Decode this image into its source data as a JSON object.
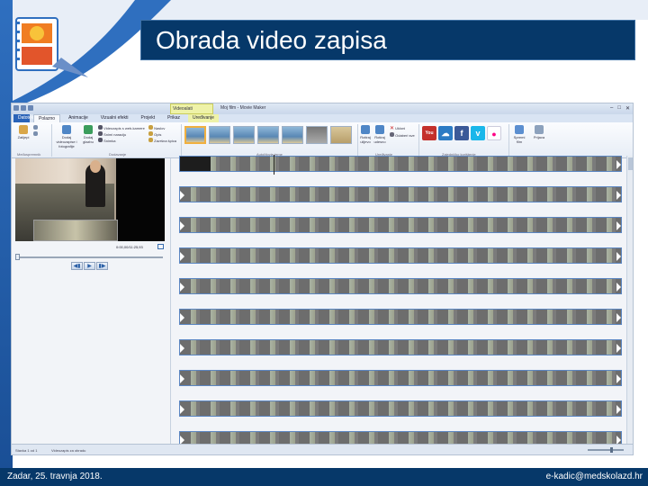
{
  "slide": {
    "title": "Obrada video zapisa",
    "footer_left": "Zadar, 25. travnja 2018.",
    "footer_right": "e-kadic@medskolazd.hr"
  },
  "colors": {
    "slide_dark_blue": "#063869",
    "accent_blue": "#2f6fbf",
    "selected_theme": "#f0b040"
  },
  "app": {
    "window_title": "Moj film - Movie Maker",
    "context_label": "Videoalati",
    "tabs": [
      "Datoteka",
      "Polazno",
      "Animacije",
      "Vizualni efekti",
      "Projekt",
      "Prikaz",
      "Uređivanje"
    ],
    "ribbon": {
      "clipboard": {
        "paste": "Zalijepi",
        "group": "Međuspremnik"
      },
      "add": {
        "add_video": "Dodaj videozapise i fotografije",
        "add_music": "Dodaj glazbu",
        "webcam": "Videozapis s web-kamere",
        "narration": "Snimi naraciju",
        "snapshot": "Snimka",
        "title": "Naslov",
        "caption": "Opis",
        "credits": "Završna špica",
        "group": "Dodavanje"
      },
      "themes_group": "AutoMovie teme",
      "editing": {
        "rotate_left": "Rotiraj ulijevo",
        "rotate_right": "Rotiraj udesno",
        "remove": "Ukloni",
        "select_all": "Odaberi sve",
        "group": "Uređivanje"
      },
      "share_group": "Zajedničko korištenje",
      "save_movie": "Spremi film",
      "sign_in": "Prijava"
    },
    "preview": {
      "timecode": "0:00,00/11:25,93"
    },
    "status": {
      "item": "Stavka 1 od 1",
      "hint": "Videozapis za obradu"
    }
  }
}
